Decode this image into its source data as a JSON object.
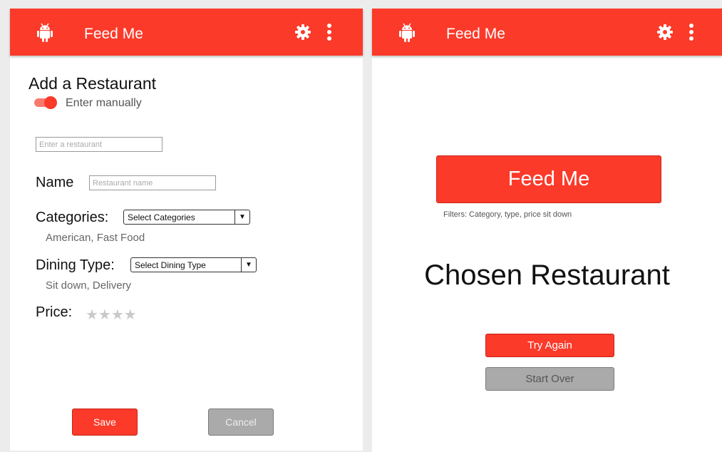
{
  "colors": {
    "primary": "#fb3a2a",
    "neutral_button": "#aaaaaa"
  },
  "left_screen": {
    "appbar": {
      "title": "Feed Me",
      "left_icon": "android-icon",
      "right_icons": [
        "gear-icon",
        "more-vert-icon"
      ]
    },
    "heading": "Add a Restaurant",
    "toggle": {
      "label": "Enter manually",
      "on": true
    },
    "restaurant_input": {
      "placeholder": "Enter a restaurant",
      "value": ""
    },
    "name_field": {
      "label": "Name",
      "placeholder": "Restaurant name"
    },
    "categories": {
      "label": "Categories:",
      "select_value": "Select Categories",
      "selected": "American, Fast Food"
    },
    "dining_type": {
      "label": "Dining Type:",
      "select_value": "Select Dining Type",
      "selected": "Sit down, Delivery"
    },
    "price": {
      "label": "Price:",
      "stars": "★★★★",
      "rating": 0,
      "max": 4
    },
    "save_label": "Save",
    "cancel_label": "Cancel"
  },
  "right_screen": {
    "appbar": {
      "title": "Feed Me",
      "left_icon": "android-icon",
      "right_icons": [
        "gear-icon",
        "more-vert-icon"
      ]
    },
    "feed_me_button": "Feed Me",
    "filters_text": "Filters: Category, type, price sit down",
    "chosen_restaurant": "Chosen Restaurant",
    "try_again_label": "Try Again",
    "start_over_label": "Start Over"
  }
}
